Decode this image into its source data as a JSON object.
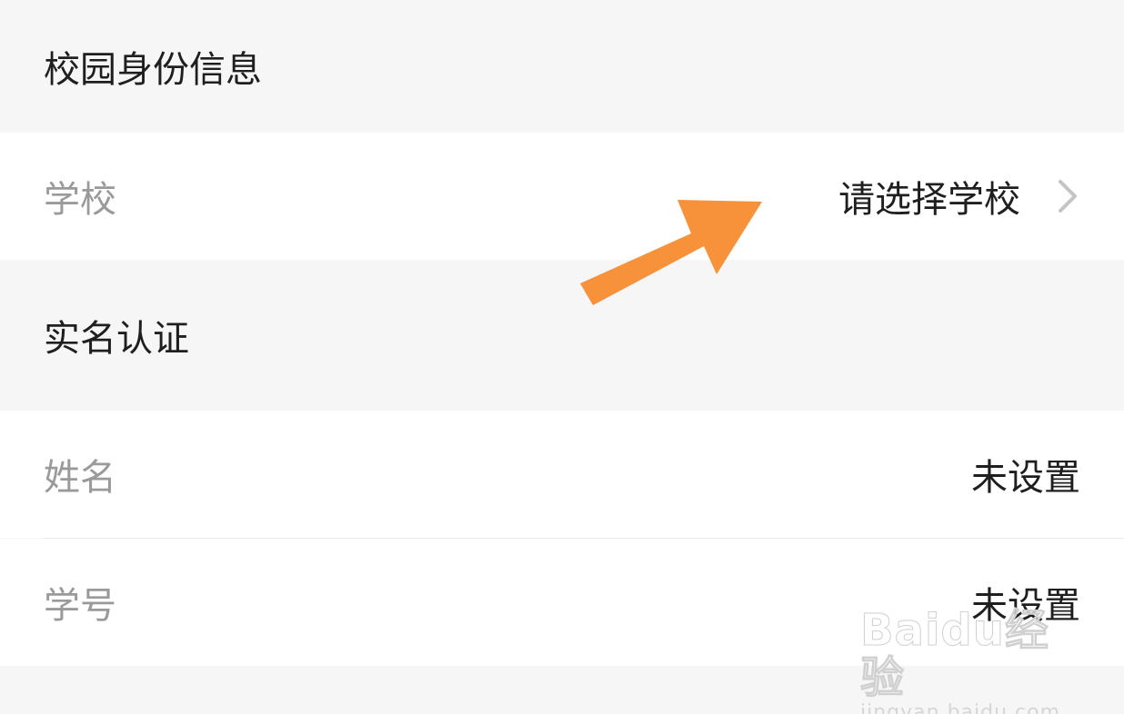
{
  "sections": {
    "campus": {
      "title": "校园身份信息",
      "school": {
        "label": "学校",
        "value": "请选择学校"
      }
    },
    "realname": {
      "title": "实名认证",
      "name": {
        "label": "姓名",
        "value": "未设置"
      },
      "student_id": {
        "label": "学号",
        "value": "未设置"
      }
    }
  },
  "watermark": {
    "brand": "Baidu经验",
    "domain": "jingyan.baidu.com"
  },
  "colors": {
    "background": "#f6f6f6",
    "row_background": "#ffffff",
    "label_text": "#9a9a9a",
    "value_text": "#1f1f1f",
    "annotation_arrow": "#f7913a"
  },
  "icons": {
    "school_row": "chevron-right-icon",
    "annotation": "arrow-annotation"
  }
}
